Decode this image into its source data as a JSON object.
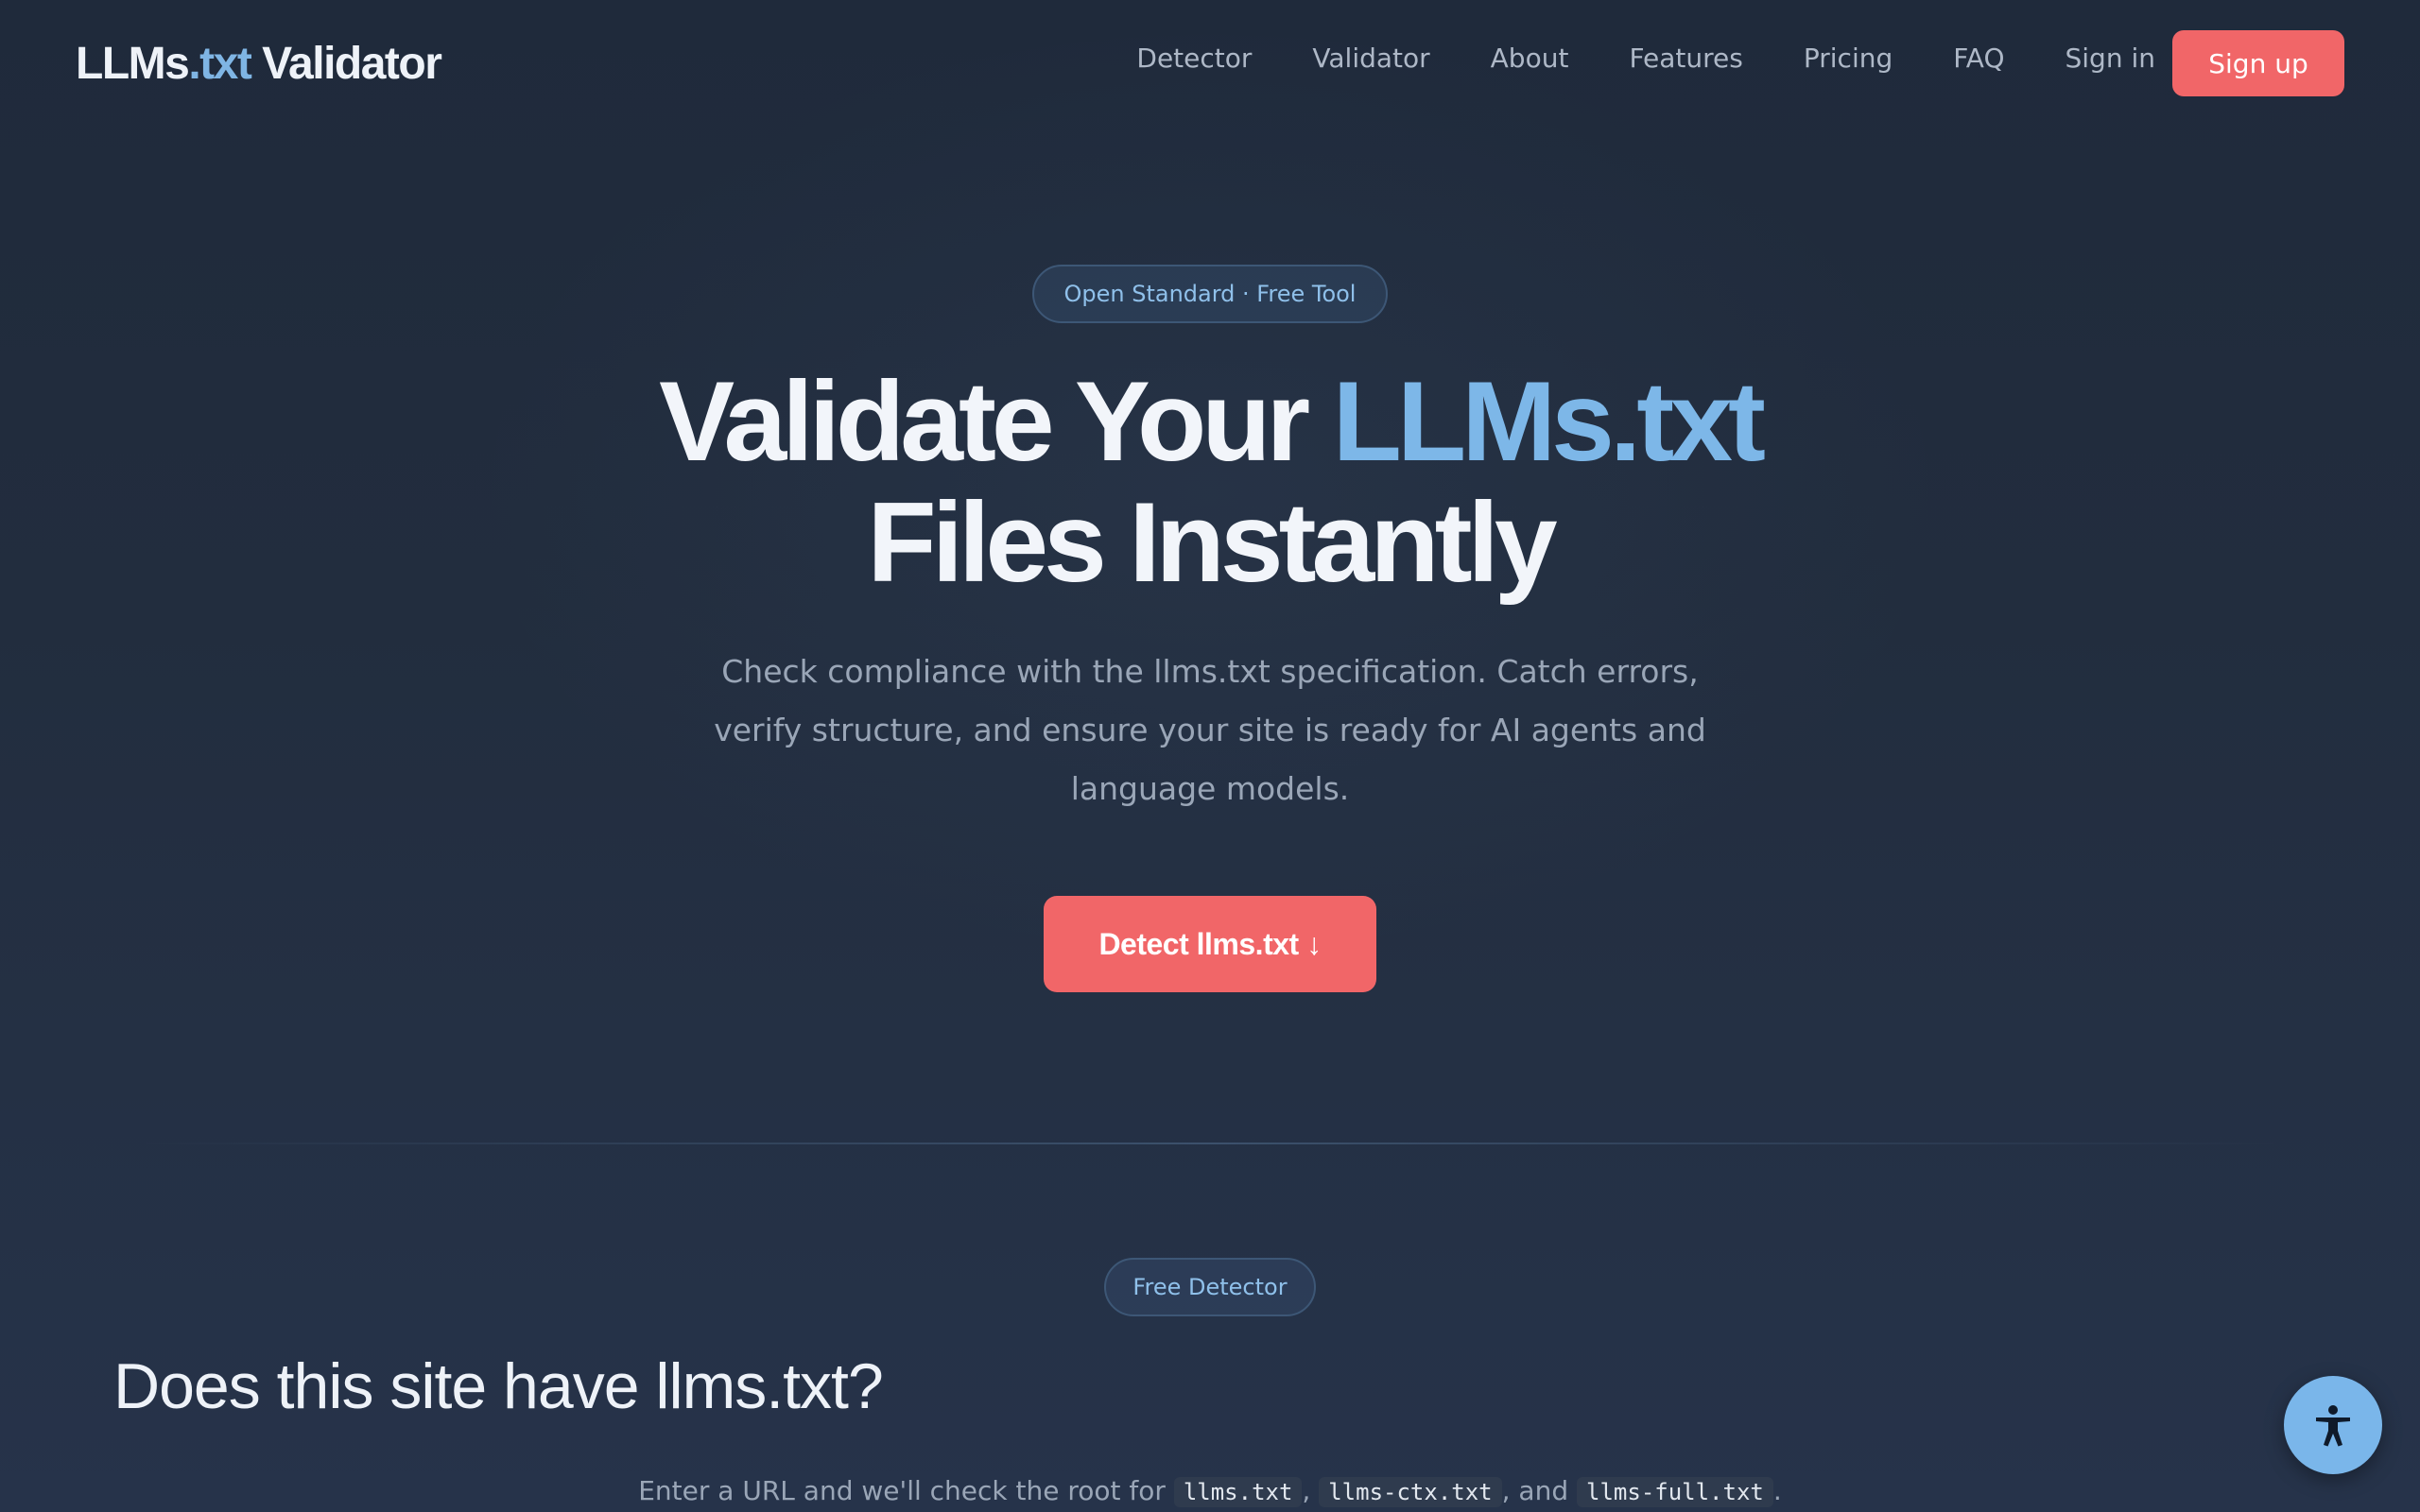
{
  "header": {
    "logo_main": "LLMs",
    "logo_accent": ".txt",
    "logo_rest": " Validator",
    "nav": [
      "Detector",
      "Validator",
      "About",
      "Features",
      "Pricing",
      "FAQ",
      "Sign in"
    ],
    "signup_label": "Sign up"
  },
  "hero": {
    "badge": "Open Standard · Free Tool",
    "title_part1": "Validate Your ",
    "title_accent": "LLMs.txt",
    "title_part2": "Files Instantly",
    "subtitle": "Check compliance with the llms.txt specification. Catch errors, verify structure, and ensure your site is ready for AI agents and language models.",
    "cta_label": "Detect llms.txt ↓"
  },
  "detector": {
    "badge": "Free Detector",
    "title": "Does this site have llms.txt?",
    "sub_prefix": "Enter a URL and we'll check the root for ",
    "file1": "llms.txt",
    "sep1": ", ",
    "file2": "llms-ctx.txt",
    "sep2": ", and ",
    "file3": "llms-full.txt",
    "sub_suffix": "."
  },
  "accessibility": {
    "icon": "accessibility-icon"
  },
  "colors": {
    "accent_blue": "#7db7e8",
    "cta_red": "#f16668",
    "background": "#222d3e"
  }
}
